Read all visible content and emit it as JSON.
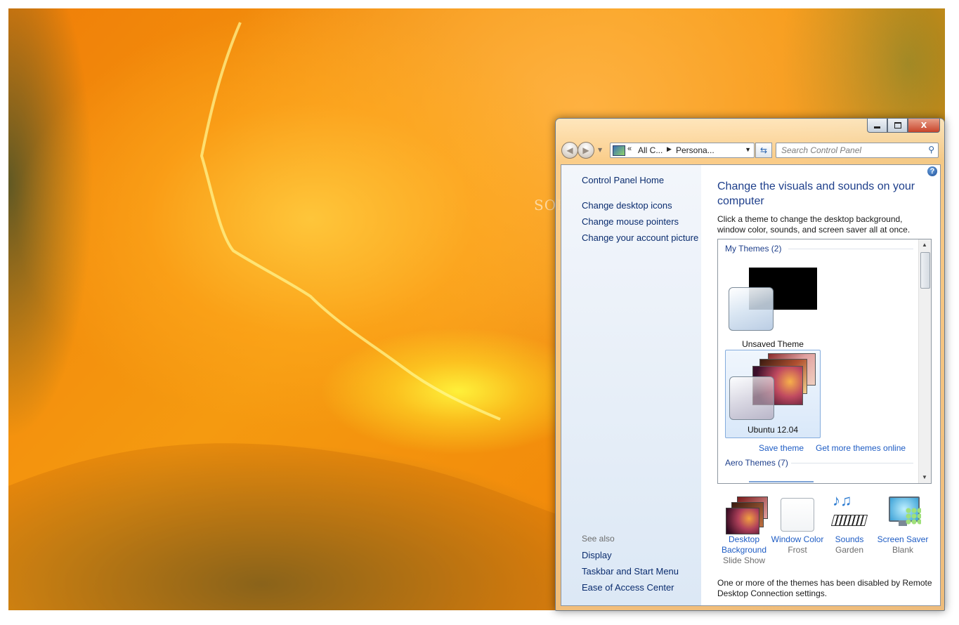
{
  "watermark": "SOFTPEDIA",
  "window": {
    "caption_buttons": {
      "minimize": "minimize",
      "maximize": "maximize",
      "close": "X"
    },
    "address": {
      "crumb1": "All C...",
      "crumb2": "Persona...",
      "recent_sep": "«"
    },
    "search": {
      "placeholder": "Search Control Panel"
    }
  },
  "sidebar": {
    "home": "Control Panel Home",
    "tasks": [
      "Change desktop icons",
      "Change mouse pointers",
      "Change your account picture"
    ],
    "see_also_label": "See also",
    "see_also": [
      "Display",
      "Taskbar and Start Menu",
      "Ease of Access Center"
    ]
  },
  "main": {
    "title": "Change the visuals and sounds on your computer",
    "description": "Click a theme to change the desktop background, window color, sounds, and screen saver all at once.",
    "groups": {
      "my_themes": "My Themes (2)",
      "aero_themes": "Aero Themes (7)"
    },
    "themes": [
      {
        "name": "Unsaved Theme",
        "selected": false
      },
      {
        "name": "Ubuntu 12.04",
        "selected": true
      }
    ],
    "save_theme": "Save theme",
    "get_more": "Get more themes online",
    "bottom": [
      {
        "label": "Desktop Background",
        "sub": "Slide Show",
        "icon": "desktop-background-icon"
      },
      {
        "label": "Window Color",
        "sub": "Frost",
        "icon": "window-color-icon"
      },
      {
        "label": "Sounds",
        "sub": "Garden",
        "icon": "sounds-icon"
      },
      {
        "label": "Screen Saver",
        "sub": "Blank",
        "icon": "screen-saver-icon"
      }
    ],
    "note": "One or more of the themes has been disabled by Remote Desktop Connection settings."
  }
}
